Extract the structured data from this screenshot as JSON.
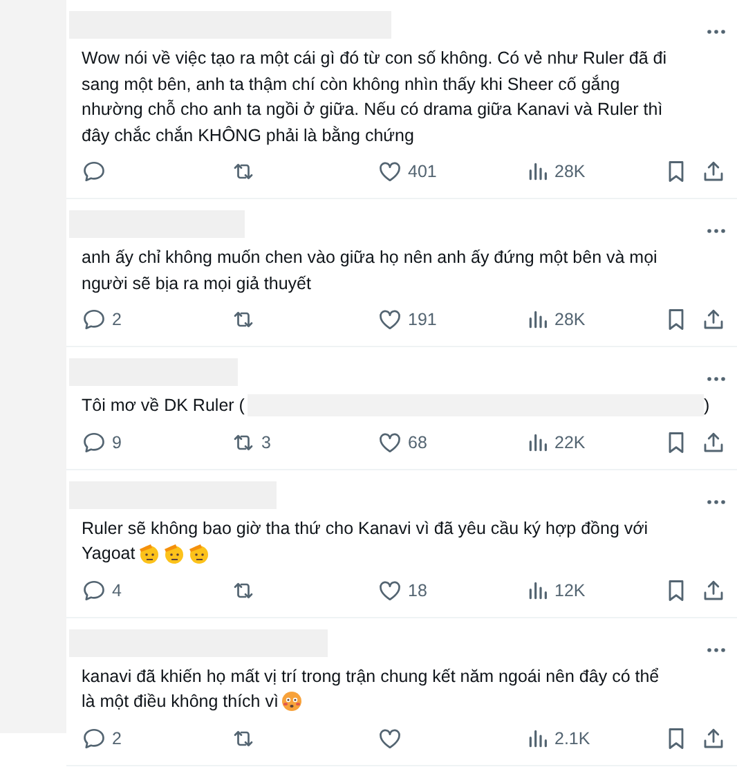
{
  "replies": [
    {
      "text": "Wow nói về việc tạo ra một cái gì đó từ con số không. Có vẻ như Ruler đã đi sang một bên, anh ta thậm chí còn không nhìn thấy khi Sheer cố gắng nhường chỗ cho anh ta ngồi ở giữa. Nếu có drama giữa Kanavi và Ruler thì đây chắc chắn KHÔNG phải là bằng chứng",
      "likes": "401",
      "views": "28K"
    },
    {
      "text": "anh ấy chỉ không muốn chen vào giữa họ nên anh ấy đứng một bên và mọi người sẽ bịa ra mọi giả thuyết",
      "replies": "2",
      "likes": "191",
      "views": "28K"
    },
    {
      "text": "Tôi mơ về DK Ruler (",
      "redacted_tail": true,
      "text_after": ")",
      "replies": "9",
      "reposts": "3",
      "likes": "68",
      "views": "22K"
    },
    {
      "text": "Ruler sẽ không bao giờ tha thứ cho Kanavi vì đã yêu cầu ký hợp đồng với",
      "last_line": "Yagoat",
      "emojis": [
        {
          "kind": "salute"
        },
        {
          "kind": "salute"
        },
        {
          "kind": "salute"
        }
      ],
      "replies": "4",
      "likes": "18",
      "views": "12K"
    },
    {
      "text": "kanavi đã khiến họ mất vị trí trong trận chung kết năm ngoái nên đây có thể",
      "last_line": "là một điều không thích vì",
      "emojis": [
        {
          "kind": "flushed"
        }
      ],
      "replies": "2",
      "views": "2.1K"
    }
  ]
}
